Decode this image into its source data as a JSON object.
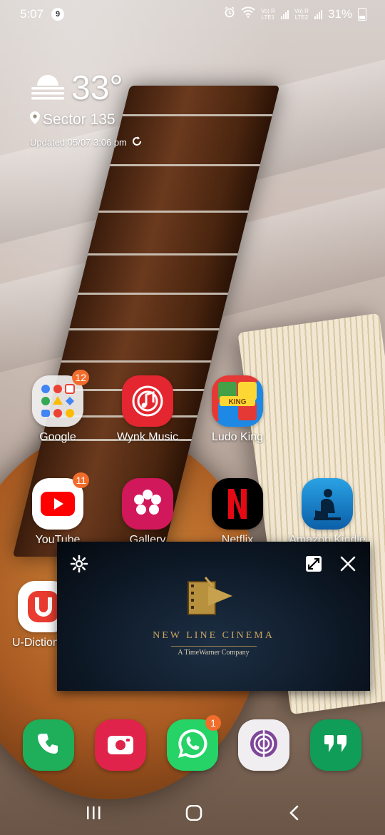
{
  "status_bar": {
    "time": "5:07",
    "notification_count": "9",
    "sim1_label": "Vo) R\nLTE1",
    "sim2_label": "Vo) R\nLTE2",
    "battery": "31%"
  },
  "weather": {
    "temperature": "33°",
    "location": "Sector 135",
    "updated": "Updated 05/07 3:06 pm"
  },
  "apps": [
    {
      "label": "Google",
      "badge": "12"
    },
    {
      "label": "Wynk Music",
      "badge": ""
    },
    {
      "label": "Ludo King",
      "badge": ""
    },
    {
      "label": "YouTube",
      "badge": "11"
    },
    {
      "label": "Gallery",
      "badge": ""
    },
    {
      "label": "Netflix",
      "badge": ""
    },
    {
      "label": "Amazon Kindle",
      "badge": ""
    },
    {
      "label": "U-Dictionary",
      "badge": ""
    }
  ],
  "popup_video": {
    "title": "NEW LINE CINEMA",
    "subtitle": "A TimeWarner Company"
  },
  "dock": {
    "whatsapp_badge": "1"
  },
  "colors": {
    "badge": "#f26d2c",
    "phone": "#1fae5a",
    "camera": "#e0234a",
    "whatsapp": "#25d366",
    "tor": "#7e4798",
    "hangouts": "#0f9d58"
  }
}
